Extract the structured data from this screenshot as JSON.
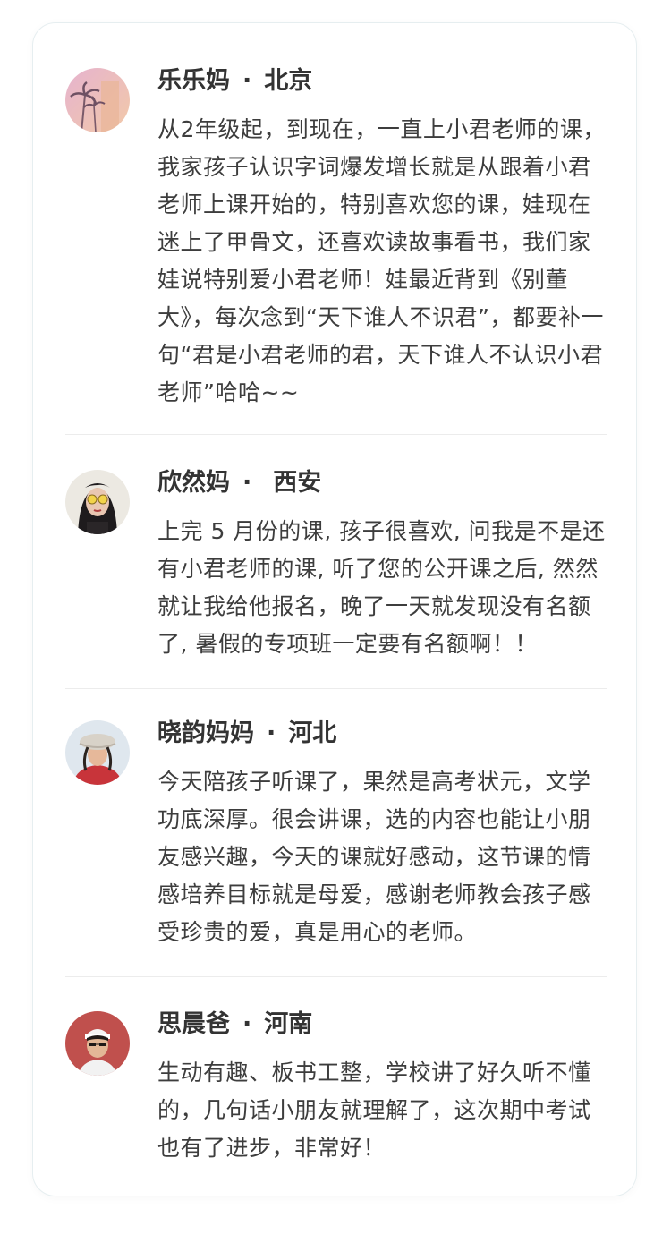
{
  "reviews": [
    {
      "name": "乐乐妈",
      "separator": "·",
      "location": "北京",
      "text": "从2年级起，到现在，一直上小君老师的课，我家孩子认识字词爆发增长就是从跟着小君老师上课开始的，特别喜欢您的课，娃现在迷上了甲骨文，还喜欢读故事看书，我们家娃说特别爱小君老师！娃最近背到《别董大》，每次念到“天下谁人不识君”，都要补一句“君是小君老师的君，天下谁人不认识小君老师”哈哈~~"
    },
    {
      "name": "欣然妈",
      "separator": "·",
      "location": "西安",
      "text": "上完 5 月份的课, 孩子很喜欢, 问我是不是还有小君老师的课, 听了您的公开课之后, 然然就让我给他报名，晚了一天就发现没有名额了, 暑假的专项班一定要有名额啊！！"
    },
    {
      "name": "晓韵妈妈",
      "separator": "·",
      "location": "河北",
      "text": "今天陪孩子听课了，果然是高考状元，文学功底深厚。很会讲课，选的内容也能让小朋友感兴趣，今天的课就好感动，这节课的情感培养目标就是母爱，感谢老师教会孩子感受珍贵的爱，真是用心的老师。"
    },
    {
      "name": "思晨爸",
      "separator": "·",
      "location": "河南",
      "text": "生动有趣、板书工整，学校讲了好久听不懂的，几句话小朋友就理解了，这次期中考试也有了进步，非常好！"
    }
  ]
}
